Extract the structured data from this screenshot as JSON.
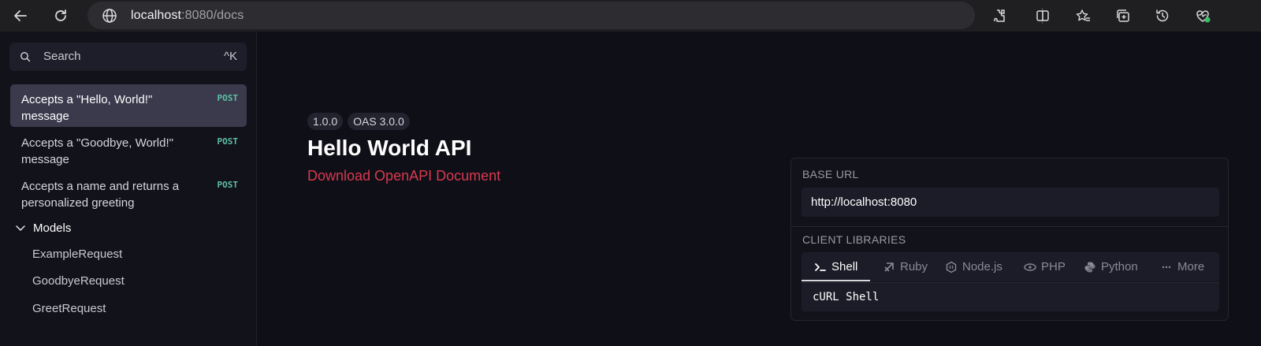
{
  "browser": {
    "url_host": "localhost",
    "url_path": ":8080/docs",
    "icons": [
      "back-arrow-icon",
      "reload-icon",
      "globe-icon",
      "extensions-icon",
      "split-screen-icon",
      "favorites-icon",
      "collections-icon",
      "history-icon",
      "browser-essentials-icon"
    ]
  },
  "sidebar": {
    "search_placeholder": "Search",
    "search_shortcut": "^K",
    "operations": [
      {
        "label": "Accepts a \"Hello, World!\" message",
        "method": "POST",
        "active": true
      },
      {
        "label": "Accepts a \"Goodbye, World!\" message",
        "method": "POST",
        "active": false
      },
      {
        "label": "Accepts a name and returns a personalized greeting",
        "method": "POST",
        "active": false
      }
    ],
    "models_label": "Models",
    "models": [
      "ExampleRequest",
      "GoodbyeRequest",
      "GreetRequest"
    ]
  },
  "main": {
    "version_badge": "1.0.0",
    "oas_badge": "OAS 3.0.0",
    "title": "Hello World API",
    "download_link": "Download OpenAPI Document"
  },
  "panel": {
    "base_url_label": "BASE URL",
    "base_url_value": "http://localhost:8080",
    "client_libraries_label": "CLIENT LIBRARIES",
    "tabs": [
      {
        "label": "Shell",
        "icon": "terminal-icon",
        "active": true
      },
      {
        "label": "Ruby",
        "icon": "ruby-icon",
        "active": false
      },
      {
        "label": "Node.js",
        "icon": "nodejs-icon",
        "active": false
      },
      {
        "label": "PHP",
        "icon": "php-icon",
        "active": false
      },
      {
        "label": "Python",
        "icon": "python-icon",
        "active": false
      },
      {
        "label": "More",
        "icon": "more-dots-icon",
        "active": false
      }
    ],
    "code_label": "cURL Shell"
  },
  "colors": {
    "accent_link": "#d83a50",
    "method_post": "#5fbfa6",
    "active_item_bg": "#3a3a4c"
  }
}
